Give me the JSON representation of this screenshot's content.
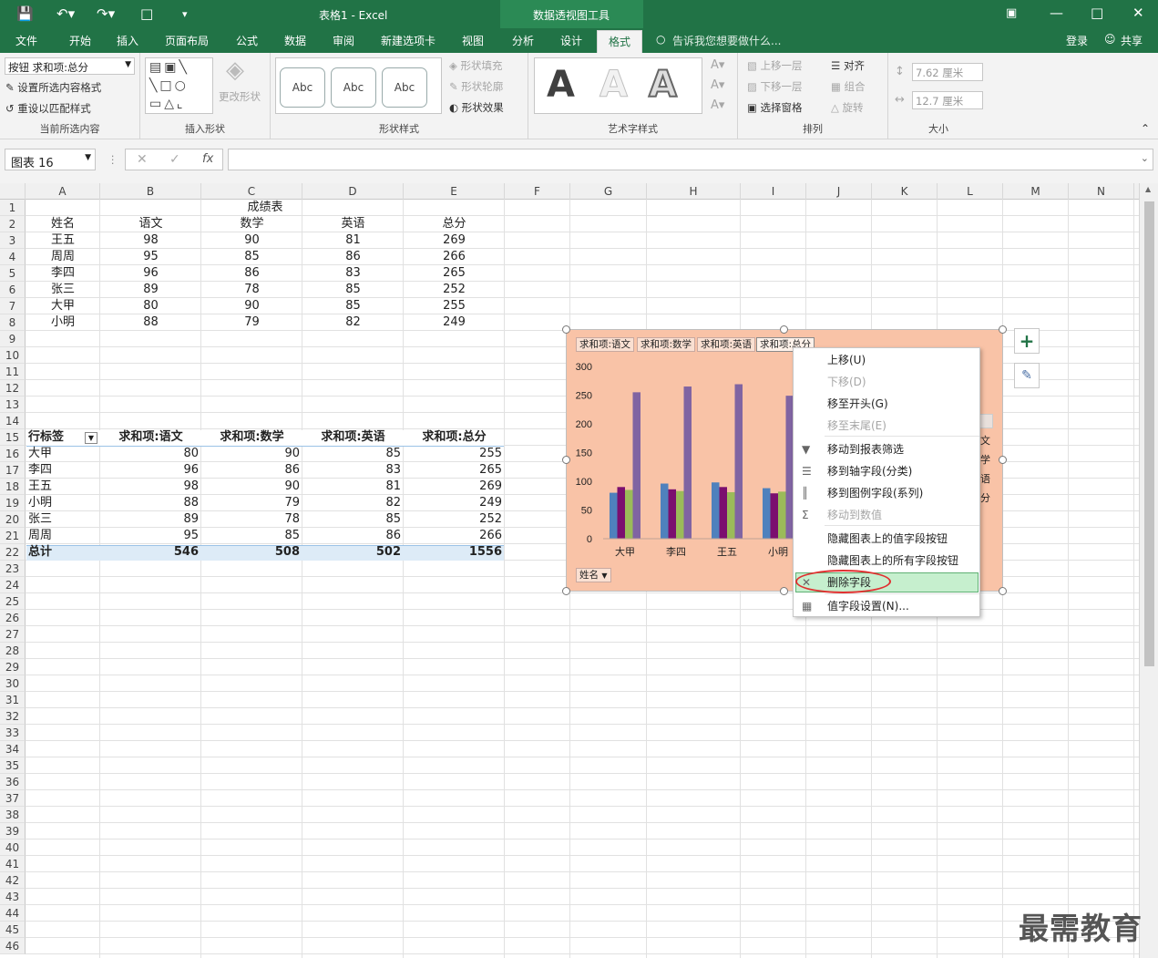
{
  "app": {
    "title": "表格1 - Excel",
    "context_tab": "数据透视图工具",
    "tell_me": "告诉我您想要做什么...",
    "login": "登录",
    "share": "共享"
  },
  "tabs": [
    "文件",
    "开始",
    "插入",
    "页面布局",
    "公式",
    "数据",
    "审阅",
    "新建选项卡",
    "视图",
    "分析",
    "设计",
    "格式"
  ],
  "active_tab": "格式",
  "ribbon": {
    "current_selection": {
      "label": "当前所选内容",
      "dropdown_value": "按钮 求和项:总分",
      "format_selection": "设置所选内容格式",
      "reset_style": "重设以匹配样式"
    },
    "insert_shapes": {
      "label": "插入形状",
      "change_shape": "更改形状"
    },
    "shape_styles": {
      "label": "形状样式",
      "presets": [
        "Abc",
        "Abc",
        "Abc"
      ],
      "fill": "形状填充",
      "outline": "形状轮廓",
      "effects": "形状效果"
    },
    "wordart": {
      "label": "艺术字样式",
      "presets": [
        "A",
        "A",
        "A"
      ]
    },
    "arrange": {
      "label": "排列",
      "bring_forward": "上移一层",
      "send_backward": "下移一层",
      "selection_pane": "选择窗格",
      "align": "对齐",
      "group": "组合",
      "rotate": "旋转"
    },
    "size": {
      "label": "大小",
      "height": "7.62 厘米",
      "width": "12.7 厘米"
    }
  },
  "formula_bar": {
    "name_box": "图表 16",
    "fx": "fx",
    "value": ""
  },
  "columns": [
    "A",
    "B",
    "C",
    "D",
    "E",
    "F",
    "G",
    "H",
    "I",
    "J",
    "K",
    "L",
    "M",
    "N"
  ],
  "rows": [
    "1",
    "2",
    "3",
    "4",
    "5",
    "6",
    "7",
    "8",
    "9",
    "10",
    "11",
    "12",
    "13",
    "14",
    "15",
    "16",
    "17",
    "18",
    "19",
    "20",
    "21",
    "22",
    "23",
    "24",
    "25",
    "26",
    "27",
    "28",
    "29",
    "30",
    "31",
    "32",
    "33",
    "34",
    "35",
    "36",
    "37",
    "38",
    "39",
    "40",
    "41",
    "42",
    "43",
    "44",
    "45",
    "46"
  ],
  "score_table": {
    "title": "成绩表",
    "headers": [
      "姓名",
      "语文",
      "数学",
      "英语",
      "总分"
    ],
    "rows": [
      [
        "王五",
        "98",
        "90",
        "81",
        "269"
      ],
      [
        "周周",
        "95",
        "85",
        "86",
        "266"
      ],
      [
        "李四",
        "96",
        "86",
        "83",
        "265"
      ],
      [
        "张三",
        "89",
        "78",
        "85",
        "252"
      ],
      [
        "大甲",
        "80",
        "90",
        "85",
        "255"
      ],
      [
        "小明",
        "88",
        "79",
        "82",
        "249"
      ]
    ]
  },
  "pivot_table": {
    "headers": [
      "行标签",
      "求和项:语文",
      "求和项:数学",
      "求和项:英语",
      "求和项:总分"
    ],
    "rows": [
      [
        "大甲",
        "80",
        "90",
        "85",
        "255"
      ],
      [
        "李四",
        "96",
        "86",
        "83",
        "265"
      ],
      [
        "王五",
        "98",
        "90",
        "81",
        "269"
      ],
      [
        "小明",
        "88",
        "79",
        "82",
        "249"
      ],
      [
        "张三",
        "89",
        "78",
        "85",
        "252"
      ],
      [
        "周周",
        "95",
        "85",
        "86",
        "266"
      ]
    ],
    "total": [
      "总计",
      "546",
      "508",
      "502",
      "1556"
    ]
  },
  "chart": {
    "field_buttons": [
      "求和项:语文",
      "求和项:数学",
      "求和项:英语",
      "求和项:总分"
    ],
    "axis_field_button": "姓名",
    "legend_partial": [
      "文",
      "学",
      "语",
      "分"
    ]
  },
  "chart_data": {
    "type": "bar",
    "categories": [
      "大甲",
      "李四",
      "王五",
      "小明"
    ],
    "ylim": [
      0,
      300
    ],
    "yticks": [
      "0",
      "50",
      "100",
      "150",
      "200",
      "250",
      "300"
    ],
    "series": [
      {
        "name": "求和项:语文",
        "values": [
          80,
          96,
          98,
          88
        ],
        "color": "#4f81bd"
      },
      {
        "name": "求和项:数学",
        "values": [
          90,
          86,
          90,
          79
        ],
        "color": "#7b0f6f"
      },
      {
        "name": "求和项:英语",
        "values": [
          85,
          83,
          81,
          82
        ],
        "color": "#9bbb59"
      },
      {
        "name": "求和项:总分",
        "values": [
          255,
          265,
          269,
          249
        ],
        "color": "#8064a2"
      }
    ],
    "grid": false
  },
  "context_menu": {
    "items": [
      {
        "label": "上移(U)",
        "enabled": true,
        "icon": ""
      },
      {
        "label": "下移(D)",
        "enabled": false,
        "icon": ""
      },
      {
        "label": "移至开头(G)",
        "enabled": true,
        "icon": ""
      },
      {
        "label": "移至末尾(E)",
        "enabled": false,
        "icon": ""
      },
      {
        "label": "移动到报表筛选",
        "enabled": true,
        "icon": "filter-icon"
      },
      {
        "label": "移到轴字段(分类)",
        "enabled": true,
        "icon": "rows-icon"
      },
      {
        "label": "移到图例字段(系列)",
        "enabled": true,
        "icon": "columns-icon"
      },
      {
        "label": "移动到数值",
        "enabled": false,
        "icon": "sigma-icon"
      },
      {
        "label": "隐藏图表上的值字段按钮",
        "enabled": true,
        "icon": ""
      },
      {
        "label": "隐藏图表上的所有字段按钮",
        "enabled": true,
        "icon": ""
      },
      {
        "label": "删除字段",
        "enabled": true,
        "icon": "delete-x-icon",
        "highlighted": true
      },
      {
        "label": "值字段设置(N)...",
        "enabled": true,
        "icon": "value-field-settings-icon"
      }
    ]
  },
  "watermark": "最需教育"
}
